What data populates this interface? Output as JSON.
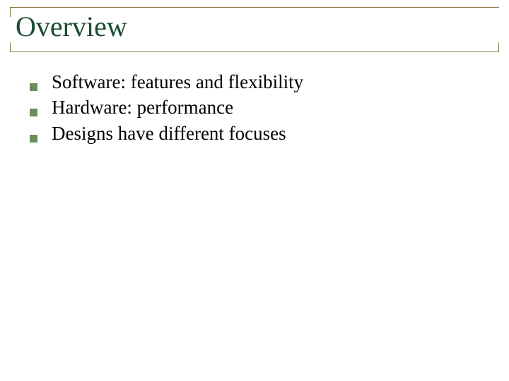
{
  "slide": {
    "title": "Overview",
    "bullets": [
      "Software: features and flexibility",
      "Hardware: performance",
      "Designs have different focuses"
    ]
  }
}
